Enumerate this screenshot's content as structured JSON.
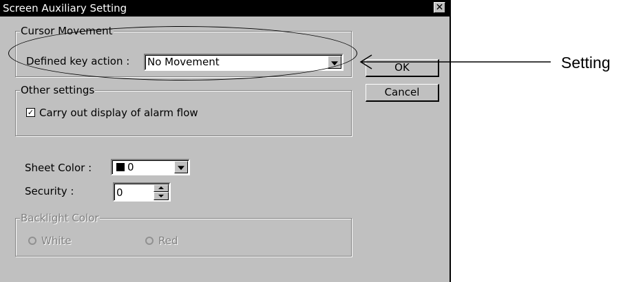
{
  "dialog": {
    "title": "Screen Auxiliary Setting",
    "close_symbol": "✕"
  },
  "cursor_movement": {
    "group_label": "Cursor Movement",
    "field_label": "Defined key action :",
    "selected": "No Movement"
  },
  "buttons": {
    "ok": "OK",
    "cancel": "Cancel"
  },
  "other_settings": {
    "group_label": "Other settings",
    "checkbox_label": "Carry out display of alarm flow",
    "checked": true,
    "check_mark": "✓"
  },
  "sheet_color": {
    "label": "Sheet Color :",
    "value": "0",
    "swatch_color": "#000000"
  },
  "security": {
    "label": "Security :",
    "value": "0"
  },
  "backlight": {
    "group_label": "Backlight Color",
    "options": [
      "White",
      "Red"
    ]
  },
  "annotation": {
    "text": "Setting"
  }
}
